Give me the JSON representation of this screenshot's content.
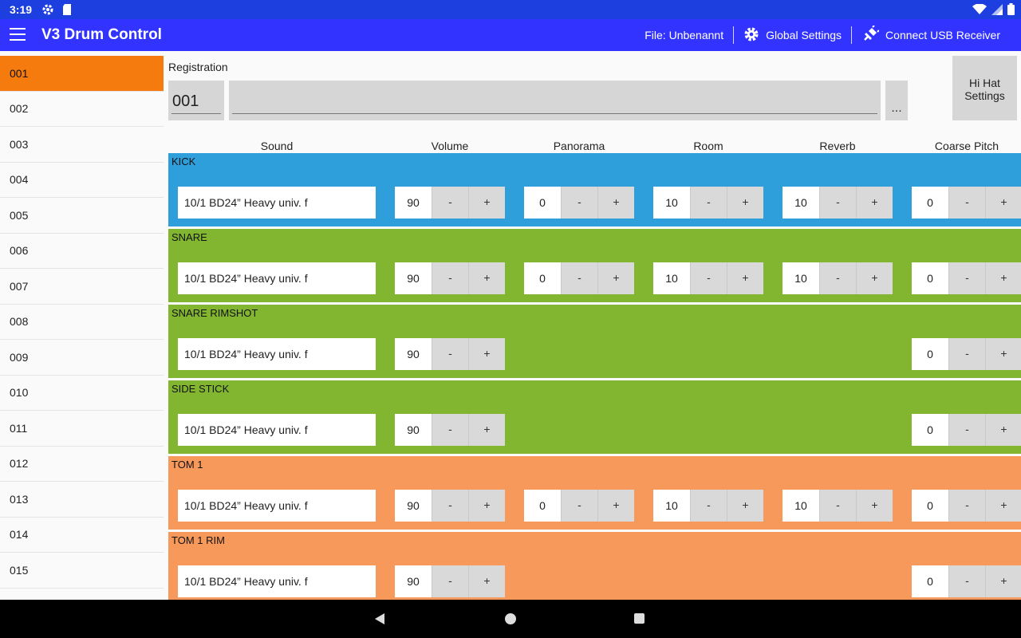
{
  "status": {
    "time": "3:19",
    "icons": [
      "gear-icon",
      "sdcard-icon",
      "wifi-icon",
      "signal-icon",
      "battery-icon"
    ]
  },
  "appbar": {
    "title": "V3 Drum Control",
    "file_label": "File: Unbenannt",
    "global_settings": "Global Settings",
    "connect_usb": "Connect USB Receiver",
    "color": "#3333ff"
  },
  "list": {
    "items": [
      "001",
      "002",
      "003",
      "004",
      "005",
      "006",
      "007",
      "008",
      "009",
      "010",
      "011",
      "012",
      "013",
      "014",
      "015"
    ],
    "selected": "001",
    "selected_color": "#f57b0f"
  },
  "registration": {
    "label": "Registration",
    "number": "001",
    "name": "",
    "more_label": "...",
    "hihat_line1": "Hi Hat",
    "hihat_line2": "Settings"
  },
  "columns": [
    "Sound",
    "Volume",
    "Panorama",
    "Room",
    "Reverb",
    "Coarse Pitch"
  ],
  "buttons": {
    "minus": "-",
    "plus": "+"
  },
  "instruments": [
    {
      "name": "KICK",
      "color": "#2f9fdc",
      "sound": "10/1 BD24” Heavy  univ.  f",
      "volume": "90",
      "panorama": "0",
      "room": "10",
      "reverb": "10",
      "coarse_pitch": "0"
    },
    {
      "name": "SNARE",
      "color": "#82b631",
      "sound": "10/1 BD24” Heavy  univ.  f",
      "volume": "90",
      "panorama": "0",
      "room": "10",
      "reverb": "10",
      "coarse_pitch": "0"
    },
    {
      "name": "SNARE RIMSHOT",
      "color": "#82b631",
      "sound": "10/1 BD24” Heavy  univ.  f",
      "volume": "90",
      "coarse_pitch": "0"
    },
    {
      "name": "SIDE STICK",
      "color": "#82b631",
      "sound": "10/1 BD24” Heavy  univ.  f",
      "volume": "90",
      "coarse_pitch": "0"
    },
    {
      "name": "TOM 1",
      "color": "#f8995c",
      "sound": "10/1 BD24” Heavy  univ.  f",
      "volume": "90",
      "panorama": "0",
      "room": "10",
      "reverb": "10",
      "coarse_pitch": "0"
    },
    {
      "name": "TOM 1 RIM",
      "color": "#f8995c",
      "sound": "10/1 BD24” Heavy  univ.  f",
      "volume": "90",
      "coarse_pitch": "0"
    }
  ]
}
